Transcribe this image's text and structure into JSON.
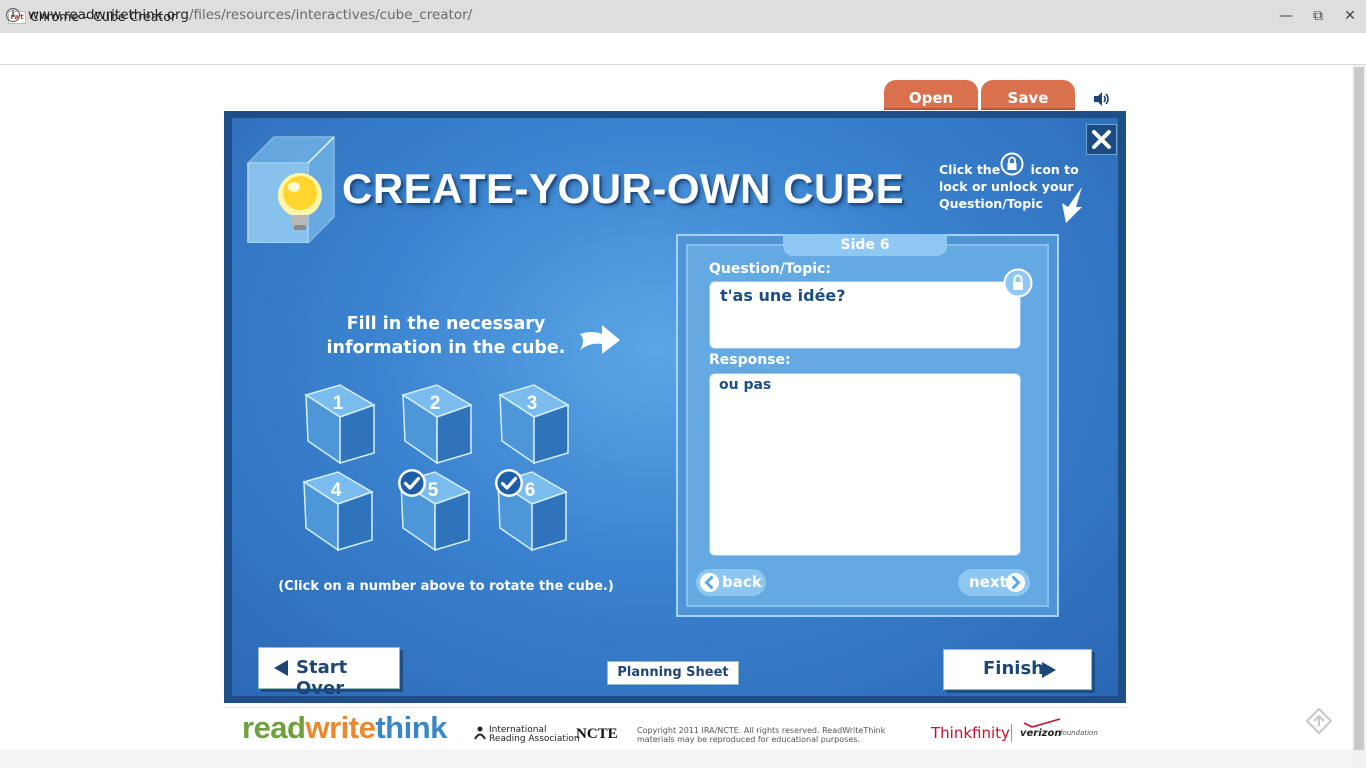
{
  "window": {
    "favicon_text": "rwt",
    "title": "Chrome – Cube Creator",
    "minimize_glyph": "—",
    "restore_glyph": "⧉",
    "close_glyph": "✕"
  },
  "address": {
    "domain": "www.readwritethink.org",
    "path": "/files/resources/interactives/cube_creator/"
  },
  "toolbar": {
    "open_label": "Open",
    "save_label": "Save"
  },
  "app": {
    "title": "CREATE-YOUR-OWN CUBE",
    "hint_line1_a": "Click the",
    "hint_line1_b": "icon  to",
    "hint_line2": "lock or unlock your",
    "hint_line3": "Question/Topic",
    "fill_line1": "Fill in the necessary",
    "fill_line2": "information in the cube.",
    "rotate_instruction": "(Click on a number above to rotate the cube.)",
    "cubes": [
      {
        "number": "1",
        "completed": false
      },
      {
        "number": "2",
        "completed": false
      },
      {
        "number": "3",
        "completed": false
      },
      {
        "number": "4",
        "completed": false
      },
      {
        "number": "5",
        "completed": true
      },
      {
        "number": "6",
        "completed": true
      }
    ]
  },
  "side_editor": {
    "side_label": "Side 6",
    "question_label": "Question/Topic:",
    "question_value": "t'as une idée?",
    "response_label": "Response:",
    "response_value": "ou pas",
    "back_label": "back",
    "next_label": "next"
  },
  "bottom": {
    "start_over_label": "Start Over",
    "planning_sheet_label": "Planning Sheet",
    "finish_label": "Finish"
  },
  "footer": {
    "logo_read": "read",
    "logo_write": "write",
    "logo_think": "think",
    "ira_line1": "International",
    "ira_line2": "Reading Association",
    "ncte": "NCTE",
    "copyright_line1": "Copyright 2011 IRA/NCTE. All rights reserved. ReadWriteThink",
    "copyright_line2": "materials may be reproduced for educational purposes.",
    "thinkfinity": "Thinkfinity",
    "verizon": "verizon",
    "verizon_suffix": "foundation"
  },
  "colors": {
    "tab_orange": "#d9714f",
    "panel_blue": "#2a68b4",
    "panel_dark": "#1f4f89",
    "text_navy": "#1d4677"
  }
}
